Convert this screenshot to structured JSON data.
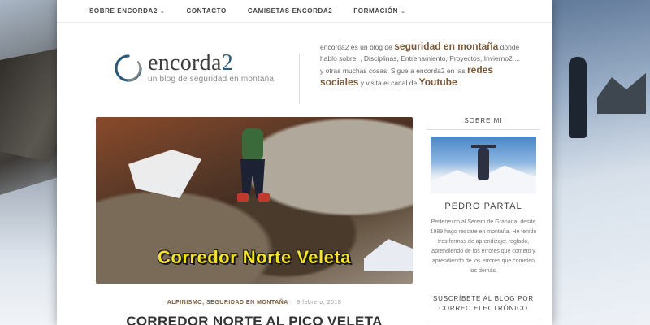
{
  "nav": {
    "items": [
      {
        "label": "SOBRE ENCORDA2",
        "has_dropdown": true
      },
      {
        "label": "CONTACTO",
        "has_dropdown": false
      },
      {
        "label": "CAMISETAS ENCORDA2",
        "has_dropdown": false
      },
      {
        "label": "FORMACIÓN",
        "has_dropdown": true
      }
    ]
  },
  "header": {
    "brand_main": "encorda",
    "brand_num": "2",
    "tagline": "un blog de seguridad en montaña",
    "intro": {
      "p1": "encorda2 es un blog de",
      "s1": "seguridad en montaña",
      "p2": "dónde hablo sobre: , Disciplinas, Entrenamiento, Proyectos, Invierno2 ... y otras muchas cosas. Sigue a encorda2 en las",
      "s2": "redes sociales",
      "p3": "y visita el canal de",
      "s3": "Youtube",
      "p4": "."
    }
  },
  "post": {
    "banner_text": "Corredor Norte Veleta",
    "categories": "ALPINISMO, SEGURIDAD EN MONTAÑA",
    "date": "9 febrero, 2018",
    "title": "CORREDOR NORTE AL PICO VELETA"
  },
  "sidebar": {
    "about_title": "SOBRE MI",
    "author_name": "PEDRO PARTAL",
    "bio": "Pertenezco al Sereim de Granada, desde 1989 hago rescate en montaña. He tenido tres formas de aprendizaje: reglado, aprendiendo de los errores que cometo y aprendiendo de los errores que cometen los demás.",
    "subscribe_title": "SUSCRÍBETE AL BLOG POR CORREO ELECTRÓNICO"
  },
  "colors": {
    "accent": "#7a5a3a",
    "brand_blue": "#2d5a78",
    "banner_yellow": "#f5e32a"
  }
}
